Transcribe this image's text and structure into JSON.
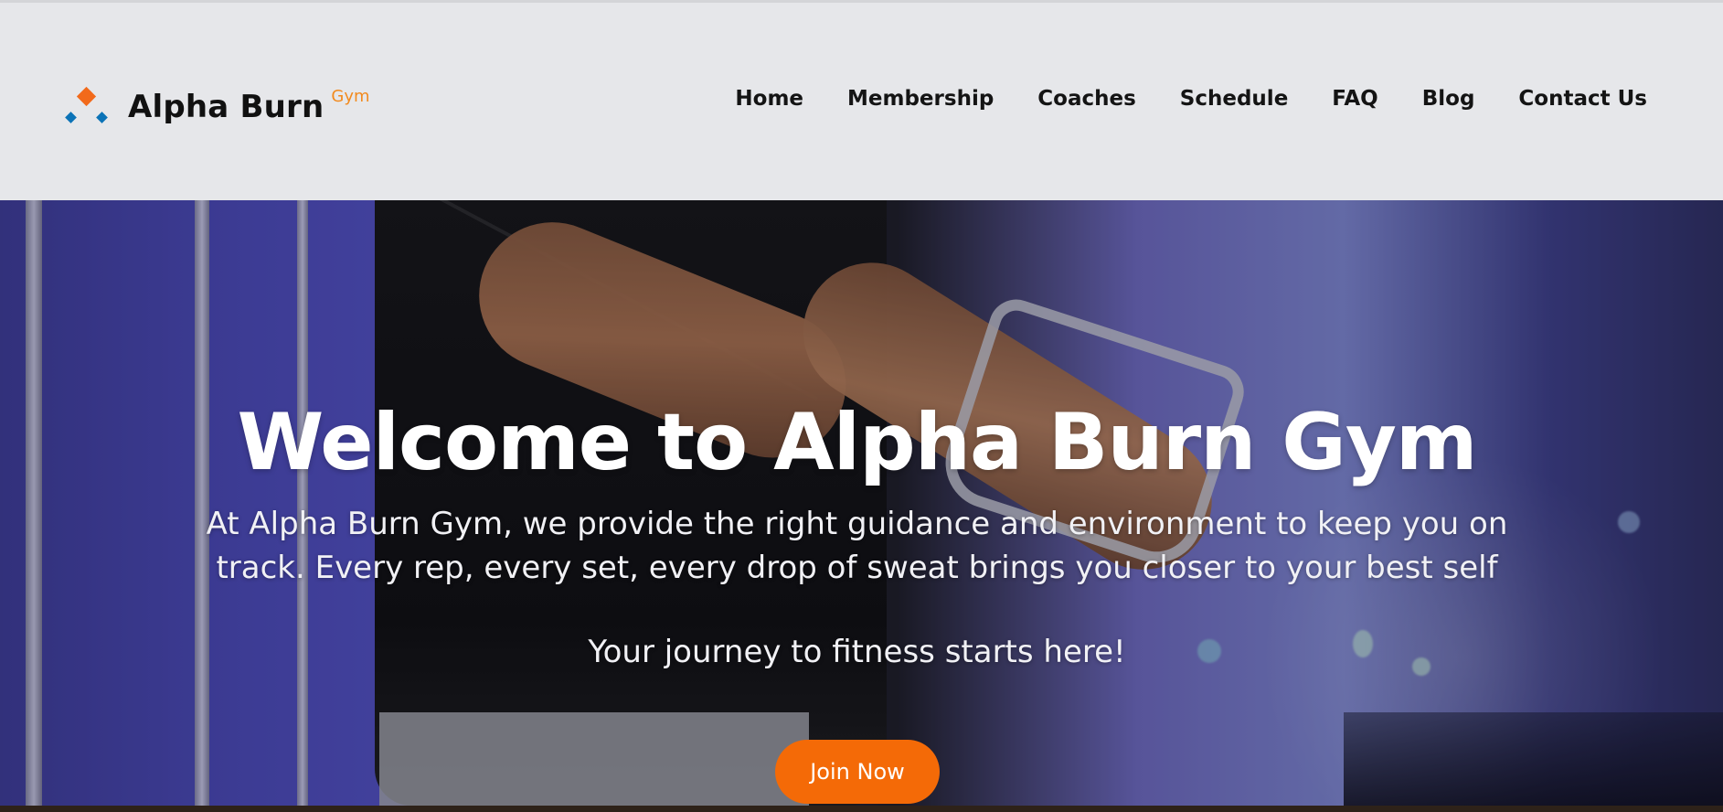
{
  "header": {
    "brand_name": "Alpha Burn",
    "brand_sup": "Gym",
    "nav": [
      {
        "label": "Home"
      },
      {
        "label": "Membership"
      },
      {
        "label": "Coaches"
      },
      {
        "label": "Schedule"
      },
      {
        "label": "FAQ"
      },
      {
        "label": "Blog"
      },
      {
        "label": "Contact Us"
      }
    ]
  },
  "hero": {
    "title": "Welcome to Alpha Burn Gym",
    "description": "At Alpha Burn Gym, we provide the right guidance and environment to keep you on track. Every rep, every set, every drop of sweat brings you closer to your best self",
    "tagline": "Your journey to fitness starts here!",
    "cta_label": "Join Now"
  },
  "colors": {
    "accent": "#f46a07",
    "logo_orange": "#f26a1b",
    "logo_blue": "#0b73b7",
    "header_bg": "#e6e7ea"
  }
}
